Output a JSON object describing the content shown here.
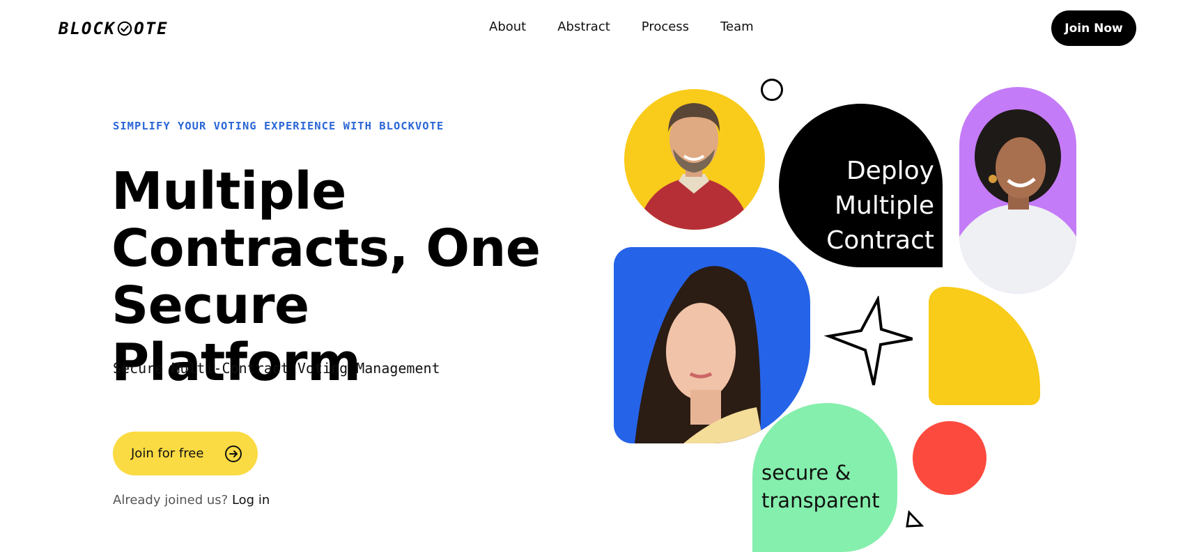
{
  "header": {
    "logo_left": "BLOCK",
    "logo_right": "OTE",
    "nav": [
      "About",
      "Abstract",
      "Process",
      "Team"
    ],
    "cta": "Join Now"
  },
  "hero": {
    "eyebrow": "SIMPLIFY YOUR VOTING EXPERIENCE WITH BLOCKVOTE",
    "headline_lines": [
      "Multiple",
      "Contracts, One",
      "Secure Platform"
    ],
    "subhead": "Secure Multi-Contract Voting Management",
    "primary_button": "Join for free",
    "login_prompt": "Already joined us?",
    "login_link": "Log in"
  },
  "collage": {
    "black_card_lines": [
      "Deploy",
      "Multiple",
      "Contract"
    ],
    "green_card_lines": [
      "secure &",
      "transparent"
    ]
  },
  "colors": {
    "eyebrow": "#2b66d6",
    "button_yellow": "#fbdb43",
    "shape_yellow": "#f9cb1b",
    "shape_blue": "#2563e8",
    "shape_purple": "#c47bf7",
    "shape_green": "#85efad",
    "shape_red": "#fd4a3e"
  },
  "icons": [
    "check-circle-icon",
    "arrow-right-circle-icon",
    "star-outline-icon",
    "ring-icon",
    "triangle-outline-icon"
  ]
}
